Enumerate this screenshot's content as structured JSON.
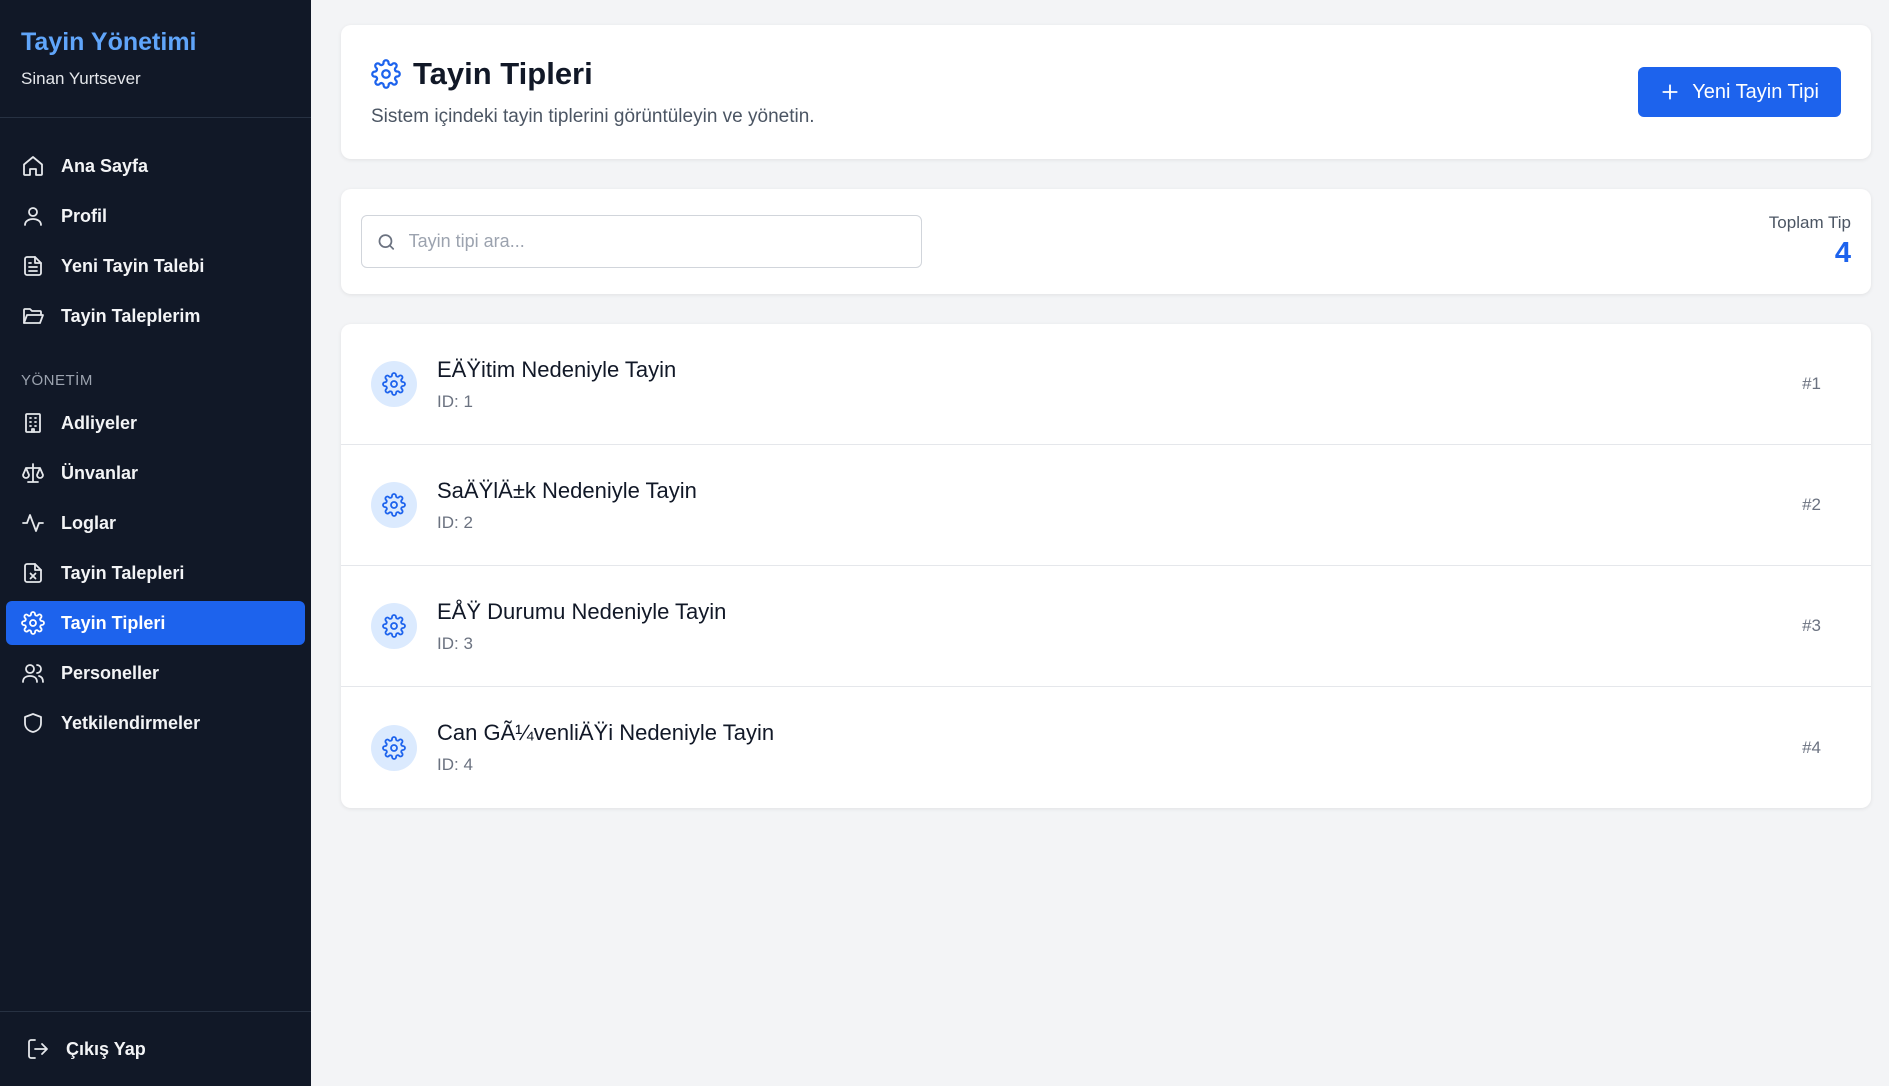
{
  "sidebar": {
    "title": "Tayin Yönetimi",
    "user": "Sinan Yurtsever",
    "items": [
      {
        "label": "Ana Sayfa",
        "icon": "home-icon"
      },
      {
        "label": "Profil",
        "icon": "user-icon"
      },
      {
        "label": "Yeni Tayin Talebi",
        "icon": "file-text-icon"
      },
      {
        "label": "Tayin Taleplerim",
        "icon": "folder-open-icon"
      }
    ],
    "section_label": "YÖNETİM",
    "admin_items": [
      {
        "label": "Adliyeler",
        "icon": "building-icon"
      },
      {
        "label": "Ünvanlar",
        "icon": "scale-icon"
      },
      {
        "label": "Loglar",
        "icon": "activity-icon"
      },
      {
        "label": "Tayin Talepleri",
        "icon": "file-x-icon"
      },
      {
        "label": "Tayin Tipleri",
        "icon": "gear-icon",
        "active": true
      },
      {
        "label": "Personeller",
        "icon": "users-icon"
      },
      {
        "label": "Yetkilendirmeler",
        "icon": "shield-icon"
      }
    ],
    "logout_label": "Çıkış Yap"
  },
  "header": {
    "title": "Tayin Tipleri",
    "subtitle": "Sistem içindeki tayin tiplerini görüntüleyin ve yönetin.",
    "new_button_label": "Yeni Tayin Tipi"
  },
  "search": {
    "placeholder": "Tayin tipi ara...",
    "value": ""
  },
  "stats": {
    "total_label": "Toplam Tip",
    "total_value": "4"
  },
  "list": [
    {
      "name": "EÄŸitim Nedeniyle Tayin",
      "id_text": "ID: 1",
      "num": "#1"
    },
    {
      "name": "SaÄŸlÄ±k Nedeniyle Tayin",
      "id_text": "ID: 2",
      "num": "#2"
    },
    {
      "name": "EÅŸ Durumu Nedeniyle Tayin",
      "id_text": "ID: 3",
      "num": "#3"
    },
    {
      "name": "Can GÃ¼venliÄŸi Nedeniyle Tayin",
      "id_text": "ID: 4",
      "num": "#4"
    }
  ],
  "colors": {
    "sidebar_bg": "#111827",
    "accent": "#1d63ed",
    "brand": "#60a5fa",
    "page_bg": "#f3f4f6"
  }
}
